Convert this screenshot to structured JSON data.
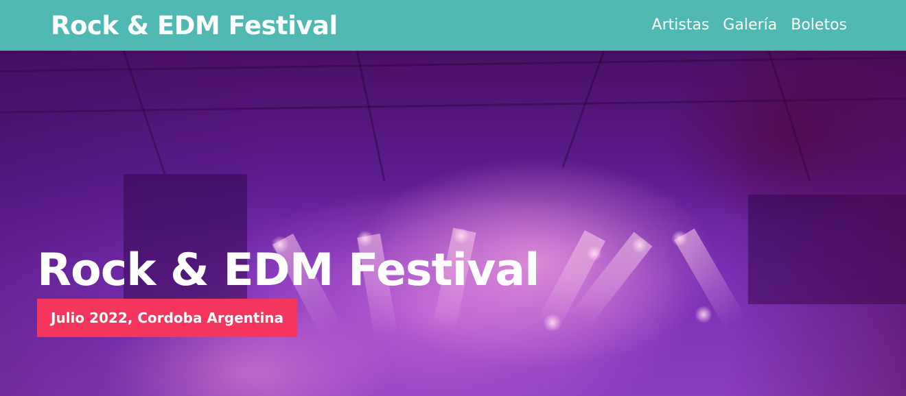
{
  "header": {
    "title": "Rock & EDM Festival",
    "nav": [
      {
        "label": "Artistas"
      },
      {
        "label": "Galería"
      },
      {
        "label": "Boletos"
      }
    ]
  },
  "hero": {
    "title": "Rock & EDM Festival",
    "date_location": "Julio 2022, Cordoba Argentina",
    "background": "concert-stage-photo"
  },
  "colors": {
    "header_bg": "#4fb8b3",
    "badge_bg": "#f4365f",
    "text": "#ffffff"
  }
}
